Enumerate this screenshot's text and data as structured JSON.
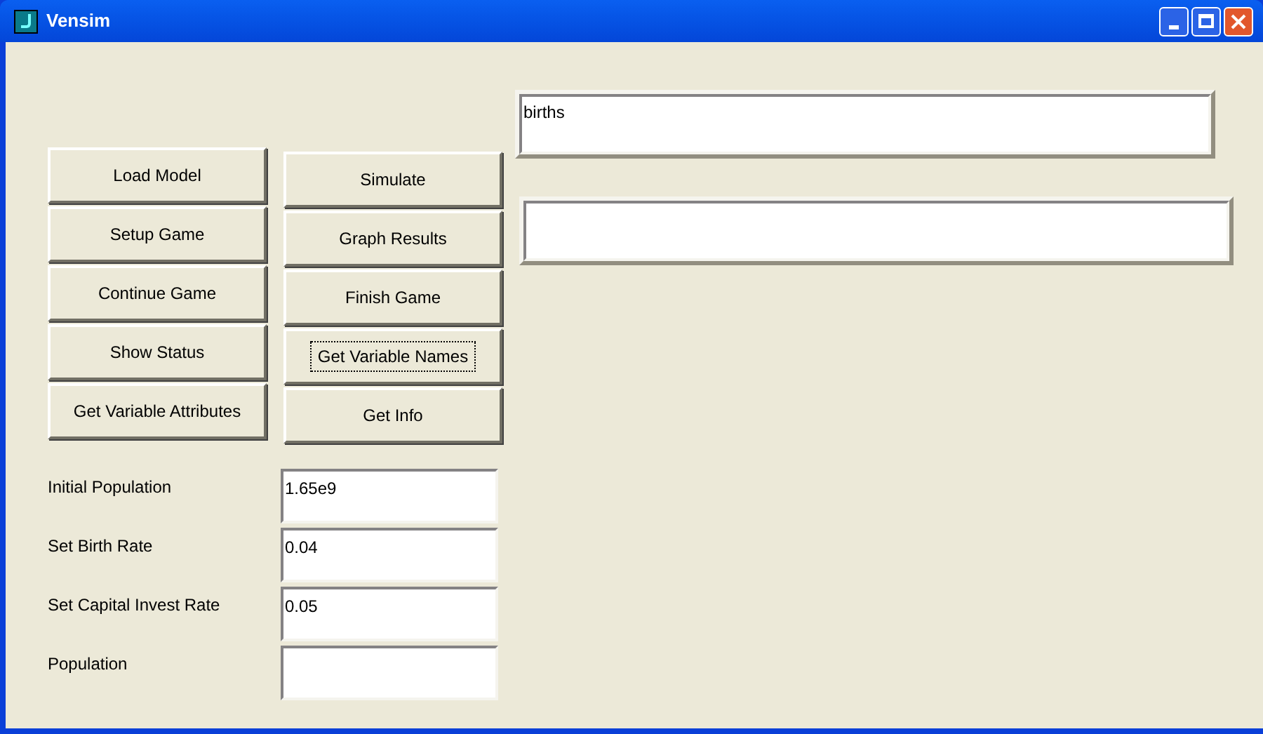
{
  "window": {
    "title": "Vensim"
  },
  "buttons_left": [
    {
      "label": "Load Model",
      "focused": false
    },
    {
      "label": "Setup Game",
      "focused": false
    },
    {
      "label": "Continue Game",
      "focused": false
    },
    {
      "label": "Show Status",
      "focused": false
    },
    {
      "label": "Get Variable Attributes",
      "focused": false
    }
  ],
  "buttons_right": [
    {
      "label": "Simulate",
      "focused": false
    },
    {
      "label": "Graph Results",
      "focused": false
    },
    {
      "label": "Finish Game",
      "focused": false
    },
    {
      "label": "Get Variable Names",
      "focused": true
    },
    {
      "label": "Get Info",
      "focused": false
    }
  ],
  "parameters": [
    {
      "label": "Initial Population",
      "value": "1.65e9"
    },
    {
      "label": "Set Birth Rate",
      "value": "0.04"
    },
    {
      "label": "Set Capital Invest Rate",
      "value": "0.05"
    },
    {
      "label": "Population"
    }
  ],
  "output_fields": [
    {
      "value": "births"
    }
  ]
}
